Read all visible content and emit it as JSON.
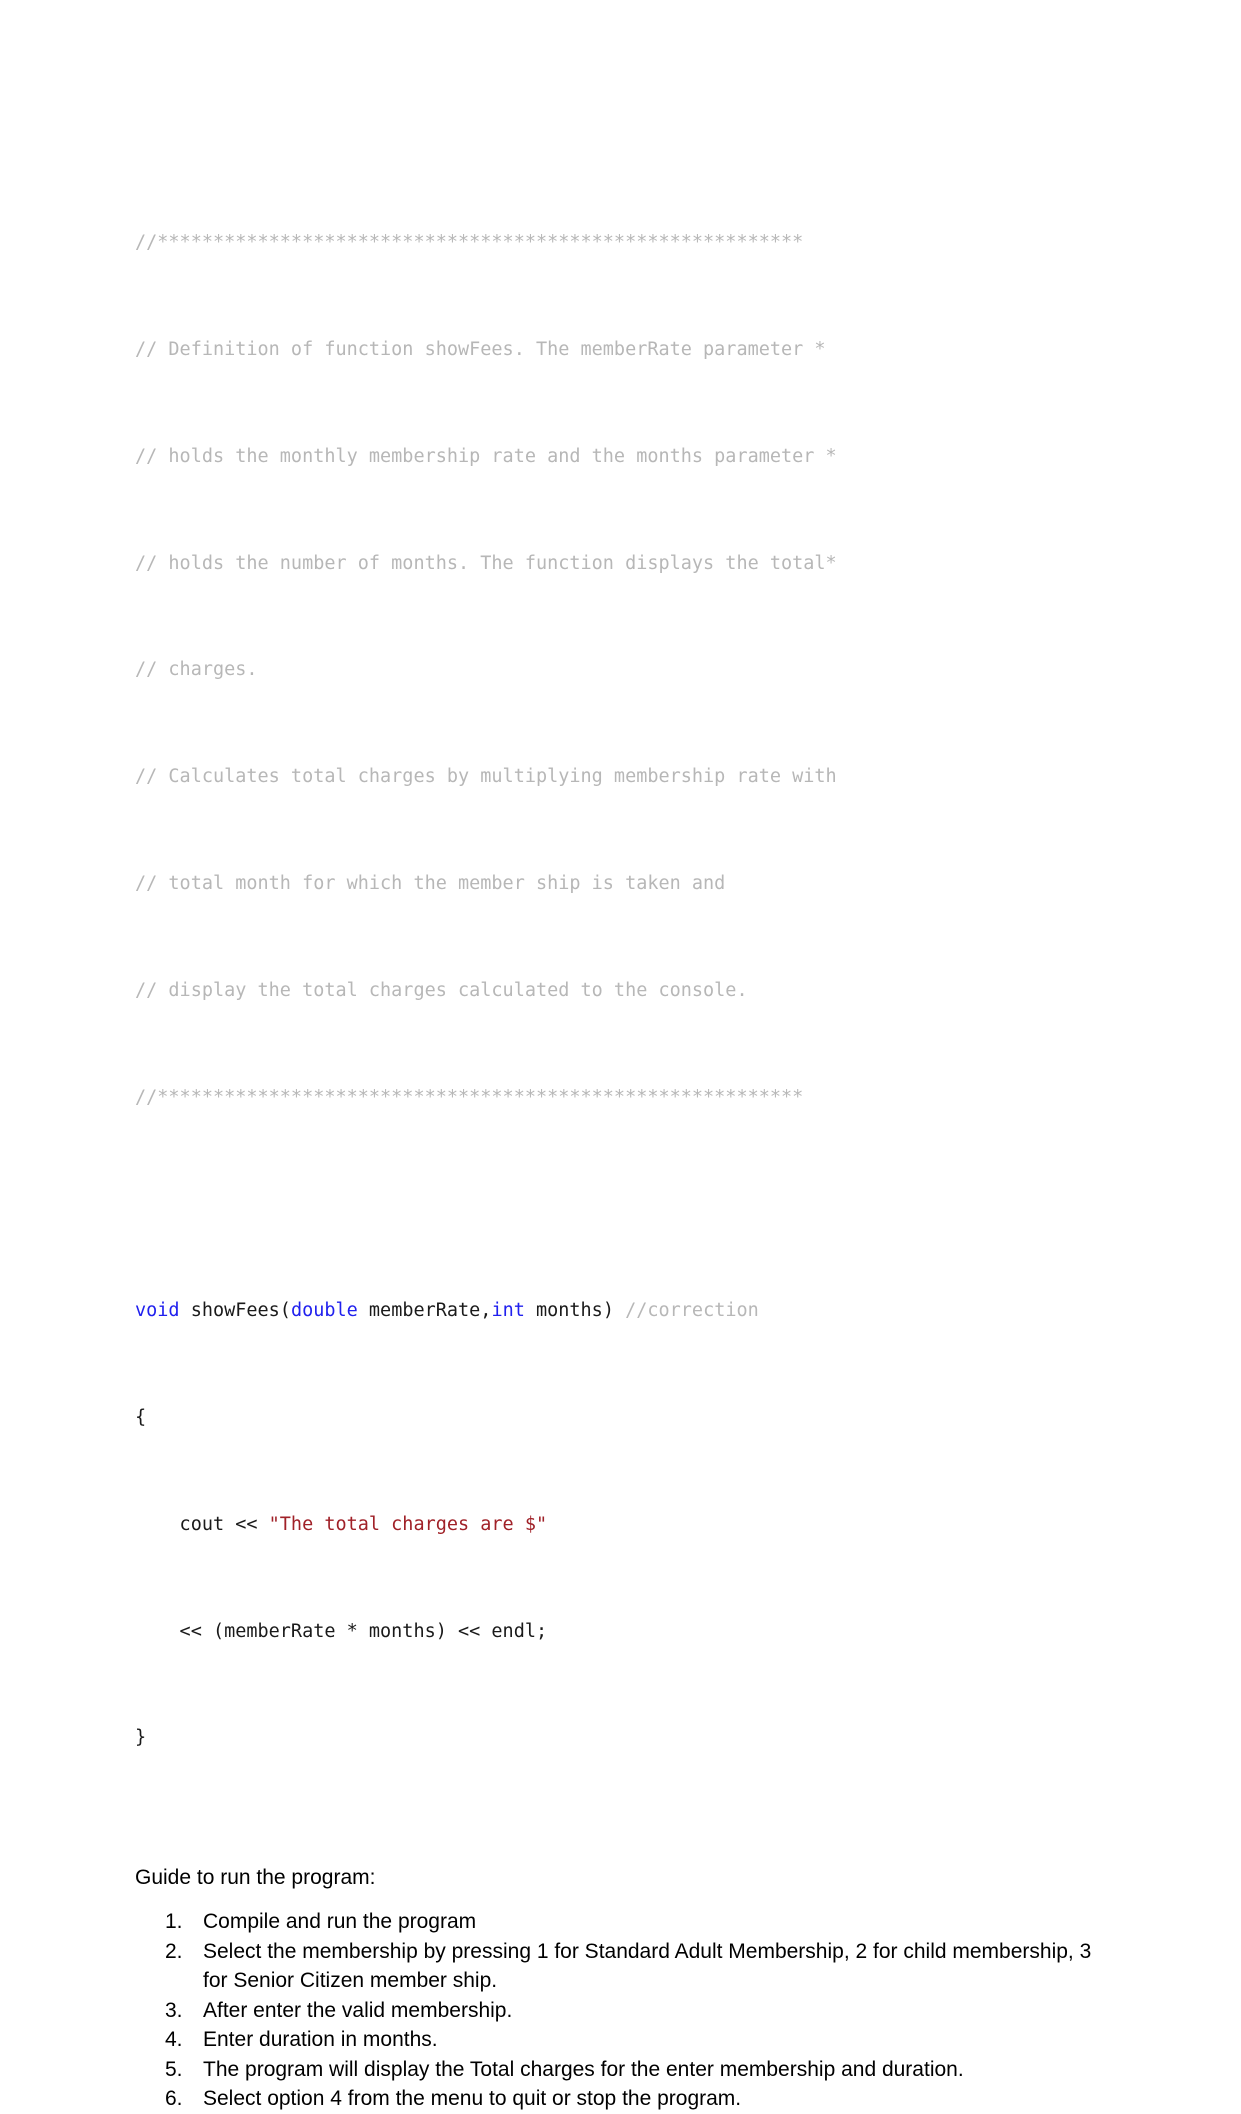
{
  "document": {
    "code": {
      "language": "cpp",
      "comment_banner_top": "//**********************************************************",
      "comment_lines": [
        "// Definition of function showFees. The memberRate parameter *",
        "// holds the monthly membership rate and the months parameter *",
        "// holds the number of months. The function displays the total*",
        "// charges.",
        "// Calculates total charges by multiplying membership rate with",
        "// total month for which the member ship is taken and",
        "// display the total charges calculated to the console."
      ],
      "comment_banner_bottom": "//**********************************************************",
      "signature": {
        "return_type": "void",
        "name": " showFees(",
        "param1_type": "double",
        "param1_name": " memberRate,",
        "param2_type": "int",
        "param2_name": " months)",
        "trailing_comment": " //correction"
      },
      "open_brace": "{",
      "cout_indent": "    cout << ",
      "cout_string": "\"The total charges are $\"",
      "expression_line": "    << (memberRate * months) << endl;",
      "close_brace": "}"
    },
    "guide": {
      "heading": "Guide to run the program:",
      "steps": [
        {
          "marker": "1.",
          "text": "Compile and run the program"
        },
        {
          "marker": "2.",
          "text": "Select the membership by pressing 1 for Standard Adult Membership, 2 for child membership, 3 for Senior Citizen member ship."
        },
        {
          "marker": "3.",
          "text": "After enter the valid membership."
        },
        {
          "marker": "4.",
          "text": "Enter duration in months."
        },
        {
          "marker": "5.",
          "text": "The program will display the Total charges for the enter membership and duration."
        },
        {
          "marker": "6.",
          "text": "Select option 4 from the menu to quit or stop the program."
        }
      ]
    },
    "colors": {
      "comment": "#b7b7b7",
      "keyword": "#2020ee",
      "string": "#a02128",
      "text": "#000000",
      "background": "#ffffff"
    }
  }
}
